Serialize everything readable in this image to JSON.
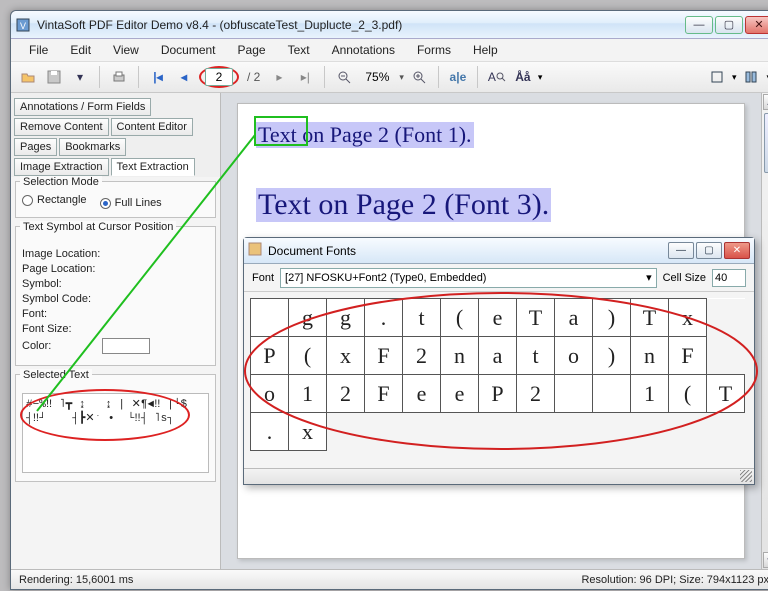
{
  "window": {
    "title": "VintaSoft PDF Editor Demo v8.4 -  (obfuscateTest_Duplucte_2_3.pdf)"
  },
  "menubar": [
    "File",
    "Edit",
    "View",
    "Document",
    "Page",
    "Text",
    "Annotations",
    "Forms",
    "Help"
  ],
  "toolbar": {
    "page_current": "2",
    "page_total": "/ 2",
    "zoom": "75%"
  },
  "left_tabs": {
    "row1": [
      "Annotations / Form Fields"
    ],
    "row2": [
      "Remove Content",
      "Content Editor"
    ],
    "row3": [
      "Pages",
      "Bookmarks"
    ],
    "row4": [
      "Image Extraction",
      "Text Extraction"
    ],
    "active": "Text Extraction"
  },
  "selection_mode": {
    "group_title": "Selection Mode",
    "rectangle_label": "Rectangle",
    "full_lines_label": "Full Lines",
    "checked": "full_lines"
  },
  "cursor_info": {
    "title": "Text Symbol at Cursor Position",
    "labels": {
      "image_location": "Image Location:",
      "page_location": "Page Location:",
      "symbol": "Symbol:",
      "symbol_code": "Symbol Code:",
      "font": "Font:",
      "font_size": "Font Size:",
      "color": "Color:"
    }
  },
  "selected_text": {
    "title": "Selected Text",
    "content": "#−%‼ ˥┳ ↨   ↨ | ✕¶◄‼ |└$\n┤‼┘    ┤┣✕ˑ •  └‼┤ ˥s┐"
  },
  "page_content": {
    "line1": "Text on Page 2 (Font 1).",
    "line2": "Text on Page 2 (Font 3)."
  },
  "fonts_window": {
    "title": "Document Fonts",
    "font_label": "Font",
    "font_value": "[27] NFOSKU+Font2 (Type0, Embedded)",
    "cellsize_label": "Cell Size",
    "cellsize_value": "40",
    "glyph_rows": [
      [
        "",
        "g",
        "g",
        ".",
        "t",
        "(",
        "e",
        "T",
        "a",
        ")",
        "T",
        "x"
      ],
      [
        "P",
        "(",
        "x",
        "F",
        "2",
        "n",
        "a",
        "t",
        "o",
        ")",
        "n",
        "F"
      ],
      [
        "o",
        "1",
        "2",
        "F",
        "e",
        "e",
        "P",
        "2",
        "",
        "",
        "1",
        "(",
        "T"
      ],
      [
        ".",
        "x"
      ]
    ]
  },
  "statusbar": {
    "left": "Rendering: 15,6001 ms",
    "right": "Resolution: 96 DPI; Size: 794x1123 px"
  },
  "colors": {
    "highlight": "#c7c7f8",
    "linktext": "#17177a",
    "red": "#d22020",
    "green": "#1fbf1f"
  }
}
